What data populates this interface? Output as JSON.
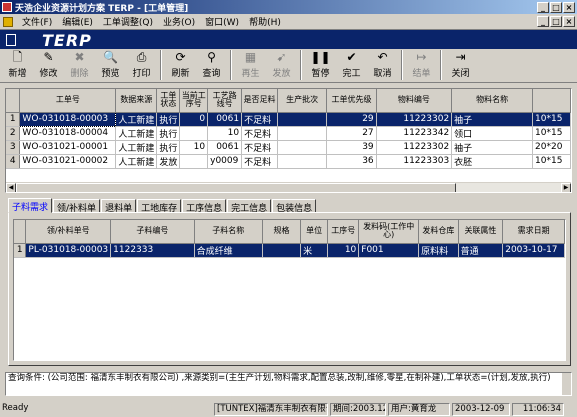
{
  "window": {
    "title": "天浩企业资源计划方案 TERP - [工单管理]",
    "controls": [
      "_",
      "□",
      "×"
    ]
  },
  "menu": {
    "items": [
      "文件(F)",
      "编辑(E)",
      "工单调整(Q)",
      "业务(O)",
      "窗口(W)",
      "帮助(H)"
    ],
    "child_controls": [
      "_",
      "□",
      "×"
    ]
  },
  "banner": {
    "logo": "TERP"
  },
  "toolbar": {
    "buttons": [
      {
        "label": "新增",
        "icon": "new-doc-icon",
        "glyph": "🗋",
        "enabled": true
      },
      {
        "label": "修改",
        "icon": "edit-icon",
        "glyph": "✎",
        "enabled": true
      },
      {
        "label": "删除",
        "icon": "delete-icon",
        "glyph": "✖",
        "enabled": false
      },
      {
        "label": "预览",
        "icon": "preview-icon",
        "glyph": "🔍",
        "enabled": true
      },
      {
        "label": "打印",
        "icon": "print-icon",
        "glyph": "⎙",
        "enabled": true
      },
      {
        "label": "刷新",
        "icon": "refresh-icon",
        "glyph": "⟳",
        "enabled": true
      },
      {
        "label": "查询",
        "icon": "binoculars-icon",
        "glyph": "⚲",
        "enabled": true
      },
      {
        "label": "再生",
        "icon": "regenerate-icon",
        "glyph": "▦",
        "enabled": false
      },
      {
        "label": "发放",
        "icon": "release-icon",
        "glyph": "➹",
        "enabled": false
      },
      {
        "label": "暂停",
        "icon": "pause-icon",
        "glyph": "❚❚",
        "enabled": true
      },
      {
        "label": "完工",
        "icon": "complete-check-icon",
        "glyph": "✔",
        "enabled": true
      },
      {
        "label": "取消",
        "icon": "undo-icon",
        "glyph": "↶",
        "enabled": true
      },
      {
        "label": "结单",
        "icon": "close-order-icon",
        "glyph": "↦",
        "enabled": false
      },
      {
        "label": "关闭",
        "icon": "exit-icon",
        "glyph": "⇥",
        "enabled": true
      }
    ]
  },
  "work_orders": {
    "columns": [
      "工单号",
      "数据来源",
      "工单状态",
      "当前工序号",
      "工艺路线号",
      "是否足料",
      "生产批次",
      "工单优先级",
      "物料编号",
      "物料名称",
      ""
    ],
    "rows": [
      {
        "no": "1",
        "cells": [
          "WO-031018-00003",
          "人工新建",
          "执行",
          "0",
          "0061",
          "不足料",
          "",
          "29",
          "11223302",
          "袖子",
          "10*15"
        ]
      },
      {
        "no": "2",
        "cells": [
          "WO-031018-00004",
          "人工新建",
          "执行",
          "",
          "10",
          "不足料",
          "",
          "27",
          "11223342",
          "领口",
          "10*15"
        ]
      },
      {
        "no": "3",
        "cells": [
          "WO-031021-00001",
          "人工新建",
          "执行",
          "10",
          "0061",
          "不足料",
          "",
          "39",
          "11223302",
          "袖子",
          "20*20"
        ]
      },
      {
        "no": "4",
        "cells": [
          "WO-031021-00002",
          "人工新建",
          "发放",
          "",
          "y0009",
          "不足料",
          "",
          "36",
          "11223303",
          "衣胚",
          "10*15"
        ]
      }
    ]
  },
  "tabs": [
    "子料需求",
    "领/补料单",
    "退料单",
    "工地库存",
    "工序信息",
    "完工信息",
    "包装信息"
  ],
  "material_needs": {
    "columns": [
      "领/补料单号",
      "子料编号",
      "子料名称",
      "规格",
      "单位",
      "工序号",
      "发料码(工作中心)",
      "发料仓库",
      "关联属性",
      "需求日期"
    ],
    "rows": [
      {
        "no": "1",
        "cells": [
          "PL-031018-00003",
          "1122333",
          "合成纤维",
          "",
          "米",
          "10",
          "F001",
          "原料料",
          "普通",
          "2003-10-17"
        ]
      }
    ]
  },
  "query": {
    "label": "查询条件:",
    "text": "(公司范围: 福清东丰制衣有限公司) ,来源类别=(主生产计划,物料需求,配置总装,改制,维修,零星,在制补建),工单状态=(计划,发放,执行)"
  },
  "statusbar": {
    "ready": "Ready",
    "company": "[TUNTEX]福清东丰制衣有限公司",
    "period": "期间:2003.12",
    "user": "用户:黄育龙",
    "date": "2003-12-09",
    "time": "11:06:34"
  }
}
